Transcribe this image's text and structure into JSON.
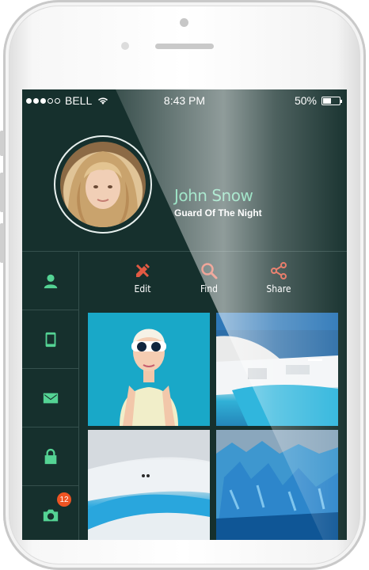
{
  "status_bar": {
    "carrier": "BELL",
    "time": "8:43 PM",
    "battery": "50%",
    "signal_bars_filled": 3,
    "signal_bars_total": 5,
    "battery_level": 0.5
  },
  "profile": {
    "name": "John Snow",
    "subtitle": "Guard Of The Night"
  },
  "sidebar": {
    "items": [
      {
        "icon": "user-icon"
      },
      {
        "icon": "phone-icon"
      },
      {
        "icon": "mail-icon"
      },
      {
        "icon": "lock-icon"
      },
      {
        "icon": "camera-icon",
        "badge": "12"
      }
    ]
  },
  "actions": [
    {
      "label": "Edit",
      "icon": "edit-icon",
      "color": "#e25a43"
    },
    {
      "label": "Find",
      "icon": "search-icon",
      "color": "#e25a43"
    },
    {
      "label": "Share",
      "icon": "share-icon",
      "color": "#e25a43"
    }
  ],
  "colors": {
    "background": "#16302d",
    "accent_green": "#54d394",
    "name_color": "#66d4a6",
    "badge": "#ee5423"
  }
}
